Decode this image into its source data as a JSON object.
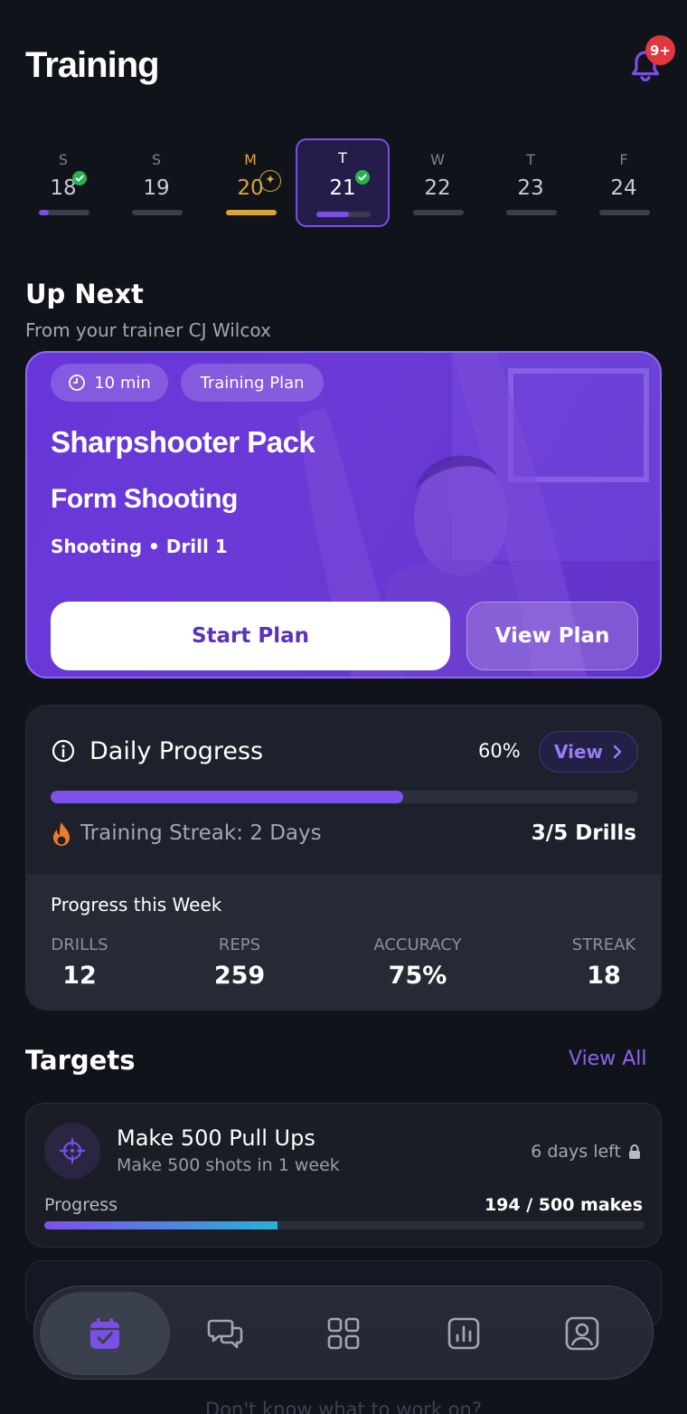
{
  "header": {
    "title": "Training",
    "notification_badge": "9+"
  },
  "week": [
    {
      "letter": "S",
      "date": "18",
      "done": true,
      "progress": 0.2
    },
    {
      "letter": "S",
      "date": "19",
      "done": false,
      "progress": 0
    },
    {
      "letter": "M",
      "date": "20",
      "done": false,
      "progress": 1.0,
      "highlight": "#d8a638"
    },
    {
      "letter": "T",
      "date": "21",
      "done": true,
      "progress": 0.6,
      "selected": true
    },
    {
      "letter": "W",
      "date": "22",
      "done": false,
      "progress": 0
    },
    {
      "letter": "T",
      "date": "23",
      "done": false,
      "progress": 0
    },
    {
      "letter": "F",
      "date": "24",
      "done": false,
      "progress": 0
    }
  ],
  "up_next": {
    "heading": "Up Next",
    "subtitle": "From your trainer CJ Wilcox",
    "duration": "10 min",
    "tag": "Training Plan",
    "pack": "Sharpshooter Pack",
    "drill": "Form Shooting",
    "meta": "Shooting • Drill 1",
    "start_label": "Start Plan",
    "view_label": "View Plan"
  },
  "daily_progress": {
    "label": "Daily Progress",
    "percent_text": "60%",
    "percent": 60,
    "view_label": "View",
    "streak": "Training Streak: 2 Days",
    "drills": "3/5 Drills",
    "week_label": "Progress this Week",
    "stats": [
      {
        "label": "DRILLS",
        "value": "12"
      },
      {
        "label": "REPS",
        "value": "259"
      },
      {
        "label": "ACCURACY",
        "value": "75%"
      },
      {
        "label": "STREAK",
        "value": "18"
      }
    ]
  },
  "targets": {
    "heading": "Targets",
    "view_all": "View All",
    "items": [
      {
        "name": "Make 500 Pull Ups",
        "desc": "Make 500 shots in 1 week",
        "time_left": "6 days left",
        "progress_label": "Progress",
        "progress_value": "194 / 500 makes",
        "fraction": 0.388
      }
    ]
  },
  "hint": "Don't know what to work on?",
  "colors": {
    "accent": "#7a4fe4",
    "background": "#11131b",
    "success": "#24b450",
    "warning": "#d8a638",
    "danger": "#e0383e"
  },
  "nav": [
    "calendar-icon",
    "chat-icon",
    "grid-icon",
    "stats-icon",
    "profile-icon"
  ]
}
